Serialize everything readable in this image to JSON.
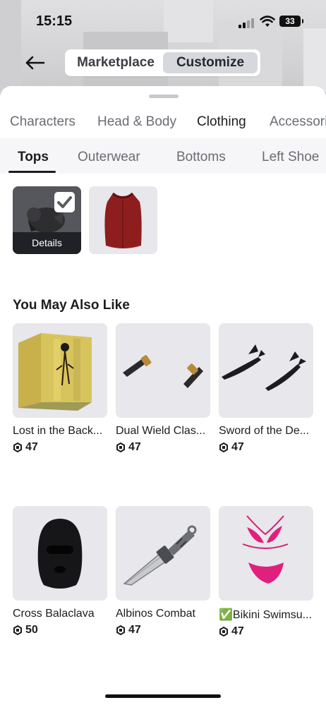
{
  "status": {
    "time": "15:15",
    "battery": "33"
  },
  "nav": {
    "back_label": "Back",
    "marketplace": "Marketplace",
    "customize": "Customize"
  },
  "category_tabs": [
    "Characters",
    "Head & Body",
    "Clothing",
    "Accessories"
  ],
  "active_category": "Clothing",
  "sub_tabs": [
    "Tops",
    "Outerwear",
    "Bottoms",
    "Left Shoe"
  ],
  "active_sub_tab": "Tops",
  "equipped": {
    "details_label": "Details"
  },
  "recommendations": {
    "title": "You May Also Like",
    "items": [
      {
        "name": "Lost in the Back...",
        "price": "47"
      },
      {
        "name": "Dual Wield Clas...",
        "price": "47"
      },
      {
        "name": "Sword of the De...",
        "price": "47"
      },
      {
        "name": "Cross Balaclava",
        "price": "50"
      },
      {
        "name": "Albinos Combat",
        "price": "47"
      },
      {
        "name": "✅Bikini Swimsu...",
        "price": "47"
      }
    ]
  },
  "colors": {
    "accent_dark": "#1f2126",
    "segment_active": "#d6d8de",
    "card_bg": "#e7e7ec"
  },
  "icons": {
    "back": "arrow-left-icon",
    "currency": "robux-icon",
    "check": "checkmark-icon"
  }
}
